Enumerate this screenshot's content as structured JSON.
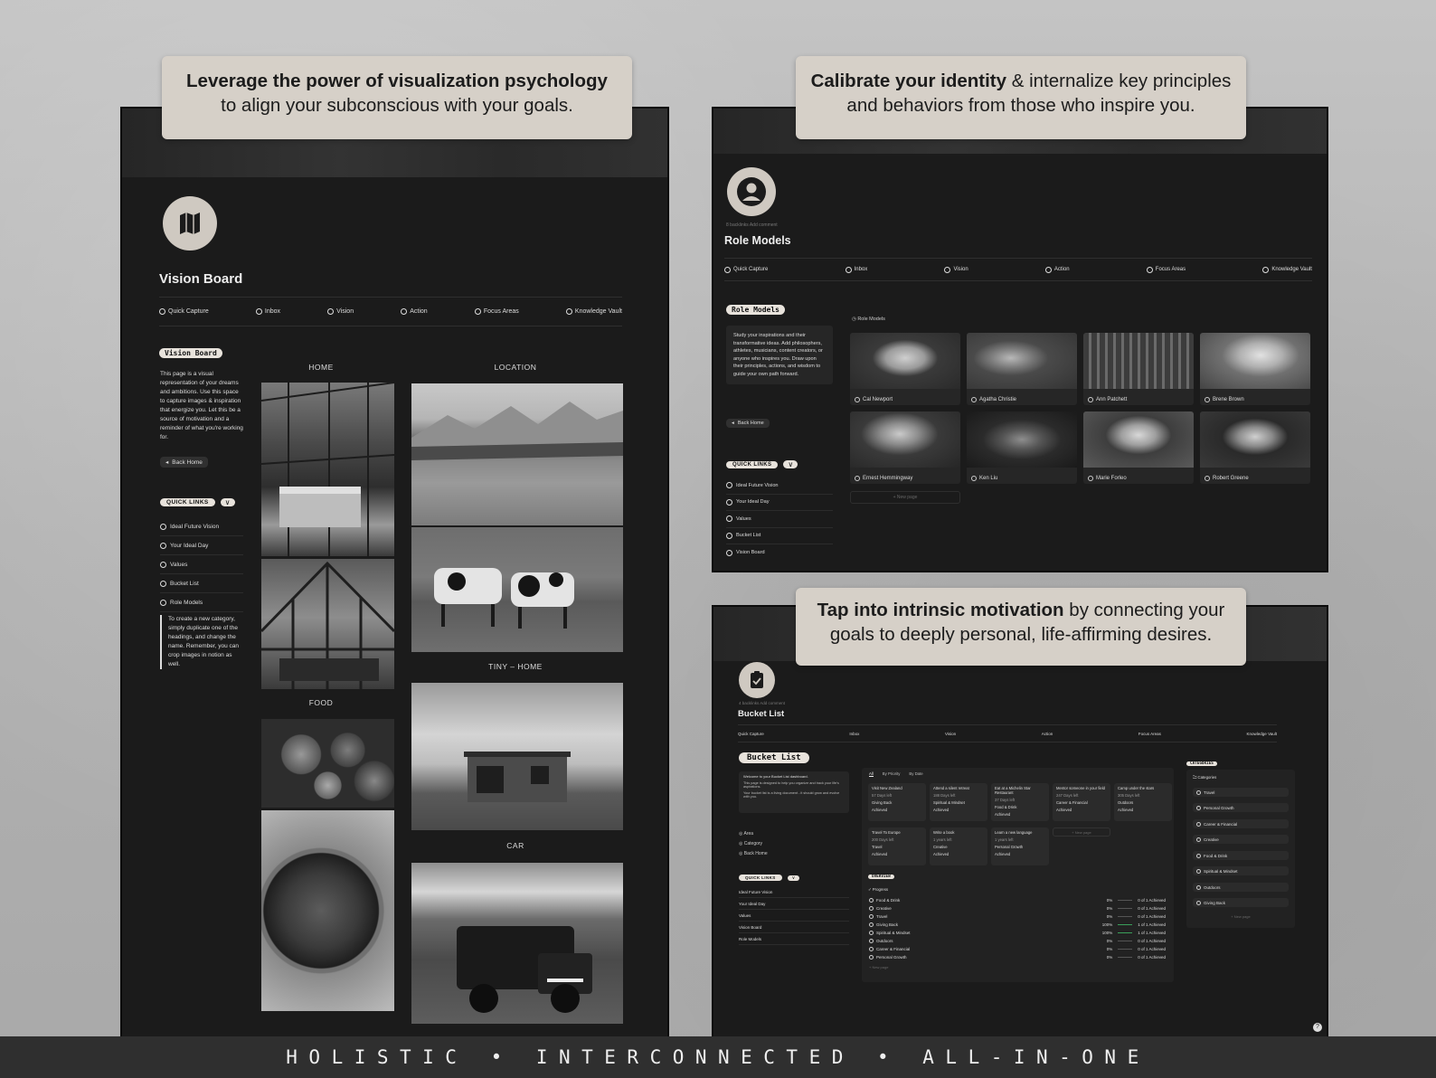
{
  "captions": {
    "vision": {
      "bold": "Leverage the power of visualization psychology",
      "rest": "to align your subconscious with your goals."
    },
    "identity": {
      "bold": "Calibrate your identity",
      "rest_line1": " & internalize key principles",
      "rest_line2": "and behaviors from those who inspire you."
    },
    "motivation": {
      "bold": "Tap into intrinsic motivation",
      "rest_line1": " by connecting your",
      "rest_line2": "goals to deeply personal, life-affirming desires."
    }
  },
  "nav": [
    "Quick Capture",
    "Inbox",
    "Vision",
    "Action",
    "Focus Areas",
    "Knowledge Vault"
  ],
  "vision_board": {
    "title": "Vision Board",
    "tag": "Vision Board",
    "description": "This page is a visual representation of your dreams and ambitions. Use this space to capture images & inspiration that energize you. Let this be a source of motivation and a reminder of what you're working for.",
    "back_home": "Back Home",
    "quick_links_label": "QUICK LINKS",
    "quick_links": [
      "Ideal Future Vision",
      "Your Ideal Day",
      "Values",
      "Bucket List",
      "Role Models"
    ],
    "callout": "To create a new category, simply duplicate one of the headings, and change the name. Remember, you can crop images in notion as well.",
    "sections": {
      "home": "HOME",
      "location": "LOCATION",
      "food": "FOOD",
      "tiny_home": "TINY – HOME",
      "car": "CAR"
    }
  },
  "role_models": {
    "title": "Role Models",
    "meta": "8 backlinks   Add comment",
    "tag": "Role Models",
    "description": "Study your inspirations and their transformative ideas. Add philosophers, athletes, musicians, content creators, or anyone who inspires you. Draw upon their principles, actions, and wisdom to guide your own path forward.",
    "back_home": "Back Home",
    "quick_links_label": "QUICK LINKS",
    "quick_links": [
      "Ideal Future Vision",
      "Your Ideal Day",
      "Values",
      "Bucket List",
      "Vision Board"
    ],
    "gallery_label": "Role Models",
    "people": [
      "Cal Newport",
      "Agatha Christie",
      "Ann Patchett",
      "Brene Brown",
      "Ernest Hemmingway",
      "Ken Liu",
      "Marie Forleo",
      "Robert Greene"
    ],
    "new_page": "+ New page"
  },
  "bucket_list": {
    "title": "Bucket List",
    "meta": "4 backlinks   Add comment",
    "tag": "Bucket List",
    "welcome": "Welcome to your Bucket List dashboard.",
    "intro1": "This page is designed to help you organize and track your life's aspirations.",
    "intro2": "Your bucket list is a living document - it should grow and evolve with you.",
    "side_links": [
      "Area",
      "Category",
      "Back Home"
    ],
    "quick_links_label": "QUICK LINKS",
    "quick_links": [
      "Ideal Future Vision",
      "Your Ideal Day",
      "Values",
      "Vision Board",
      "Role Models"
    ],
    "views": [
      "All",
      "By Priority",
      "By Date"
    ],
    "items": [
      {
        "name": "Visit New Zealand",
        "l2": "57 Days left",
        "l3": "Giving Back",
        "l4": "Achieved"
      },
      {
        "name": "Attend a silent retreat",
        "l2": "188 Days left",
        "l3": "Spiritual & Mindset",
        "l4": "Achieved"
      },
      {
        "name": "Eat at a Michelin Star Restaurant",
        "l2": "37 Days left",
        "l3": "Food & Drink",
        "l4": "Achieved"
      },
      {
        "name": "Mentor someone in your field",
        "l2": "247 Days left",
        "l3": "Career & Financial",
        "l4": "Achieved"
      },
      {
        "name": "Camp under the stars",
        "l2": "305 Days left",
        "l3": "Outdoors",
        "l4": "Achieved"
      },
      {
        "name": "Travel To Europe",
        "l2": "200 Days left",
        "l3": "Travel",
        "l4": "Achieved"
      },
      {
        "name": "Write a book",
        "l2": "1 years left",
        "l3": "Creative",
        "l4": "Achieved"
      },
      {
        "name": "Learn a new language",
        "l2": "1 years left",
        "l3": "Personal Growth",
        "l4": "Achieved"
      }
    ],
    "new_page": "+ New page",
    "overview_tag": "OVERVIEW",
    "progress_label": "Progress",
    "progress": [
      {
        "name": "Food & Drink",
        "pct": "0%",
        "count": "0 of 1 Achieved"
      },
      {
        "name": "Creative",
        "pct": "0%",
        "count": "0 of 1 Achieved"
      },
      {
        "name": "Travel",
        "pct": "0%",
        "count": "0 of 1 Achieved"
      },
      {
        "name": "Giving Back",
        "pct": "100%",
        "count": "1 of 1 Achieved"
      },
      {
        "name": "Spiritual & Mindset",
        "pct": "100%",
        "count": "1 of 1 Achieved"
      },
      {
        "name": "Outdoors",
        "pct": "0%",
        "count": "0 of 1 Achieved"
      },
      {
        "name": "Career & Financial",
        "pct": "0%",
        "count": "0 of 1 Achieved"
      },
      {
        "name": "Personal Growth",
        "pct": "0%",
        "count": "0 of 1 Achieved"
      }
    ],
    "categories_tag": "CATEGORIES",
    "categories_head": "Categories",
    "categories": [
      "Travel",
      "Personal Growth",
      "Career & Financial",
      "Creative",
      "Food & Drink",
      "Spiritual & Mindset",
      "Outdoors",
      "Giving Back"
    ]
  },
  "footer_text": "HOLISTIC • INTERCONNECTED • ALL-IN-ONE"
}
